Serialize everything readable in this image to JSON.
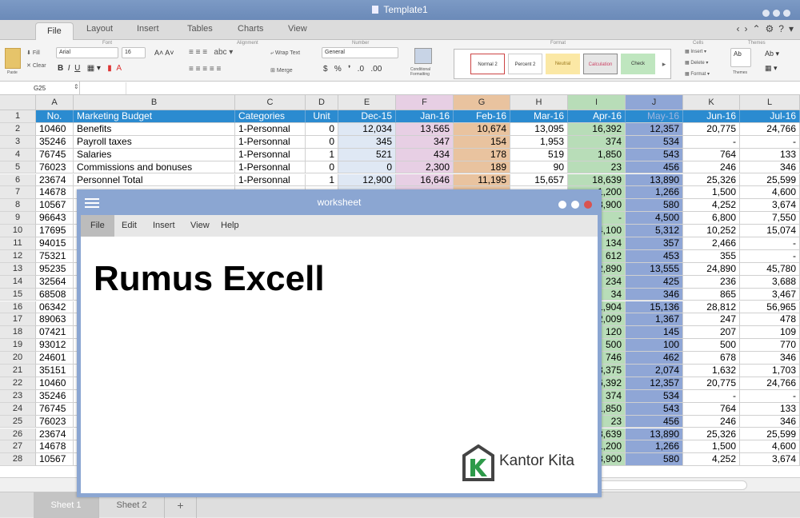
{
  "window": {
    "title": "Template1"
  },
  "tabs": [
    "File",
    "Layout",
    "Insert",
    "Tables",
    "Charts",
    "View"
  ],
  "ribbon": {
    "font_group": "Font",
    "font_name": "Arial",
    "font_size": "16",
    "alignment_group": "Alignment",
    "wrap_text": "Wrap Text",
    "merge": "Merge",
    "number_group": "Number",
    "number_format": "General",
    "format_group": "Format",
    "conditional_formatting": "Conditional Formatting",
    "styles": [
      "Normal 2",
      "Percent 2",
      "Neutral",
      "Calculation",
      "Check"
    ],
    "cells_group": "Cells",
    "cells_items": [
      "Insert",
      "Delete",
      "Format"
    ],
    "themes_group": "Themes",
    "themes_label": "Themes",
    "paste": "Paste",
    "fill": "Fill",
    "clear": "Clear"
  },
  "formula_bar": {
    "name_box": "G25"
  },
  "grid": {
    "col_letters": [
      "A",
      "B",
      "C",
      "D",
      "E",
      "F",
      "G",
      "H",
      "I",
      "J",
      "K",
      "L"
    ],
    "header": [
      "No.",
      "Marketing Budget",
      "Categories",
      "Unit",
      "Dec-15",
      "Jan-16",
      "Feb-16",
      "Mar-16",
      "Apr-16",
      "May-16",
      "Jun-16",
      "Jul-16"
    ],
    "row_numbers": [
      "1",
      "2",
      "3",
      "4",
      "5",
      "6",
      "7",
      "8",
      "9",
      "10",
      "11",
      "12",
      "13",
      "14",
      "15",
      "16",
      "17",
      "18",
      "19",
      "20",
      "21",
      "22",
      "23",
      "24",
      "25",
      "26",
      "27",
      "28"
    ],
    "rows": [
      [
        "10460",
        "Benefits",
        "1-Personnal",
        "0",
        "12,034",
        "13,565",
        "10,674",
        "13,095",
        "16,392",
        "12,357",
        "20,775",
        "24,766"
      ],
      [
        "35246",
        "Payroll taxes",
        "1-Personnal",
        "0",
        "345",
        "347",
        "154",
        "1,953",
        "374",
        "534",
        "-",
        "-"
      ],
      [
        "76745",
        "Salaries",
        "1-Personnal",
        "1",
        "521",
        "434",
        "178",
        "519",
        "1,850",
        "543",
        "764",
        "133"
      ],
      [
        "76023",
        "Commissions and bonuses",
        "1-Personnal",
        "0",
        "0",
        "2,300",
        "189",
        "90",
        "23",
        "456",
        "246",
        "346"
      ],
      [
        "23674",
        "Personnel Total",
        "1-Personnal",
        "1",
        "12,900",
        "16,646",
        "11,195",
        "15,657",
        "18,639",
        "13,890",
        "25,326",
        "25,599"
      ],
      [
        "14678",
        "",
        "",
        "",
        "",
        "",
        "",
        "",
        "1,200",
        "1,266",
        "1,500",
        "4,600"
      ],
      [
        "10567",
        "",
        "",
        "",
        "",
        "",
        "",
        "",
        "3,900",
        "580",
        "4,252",
        "3,674"
      ],
      [
        "96643",
        "",
        "",
        "",
        "",
        "",
        "",
        "",
        "-",
        "4,500",
        "6,800",
        "7,550"
      ],
      [
        "17695",
        "",
        "",
        "",
        "",
        "",
        "",
        "",
        "4,100",
        "5,312",
        "10,252",
        "15,074"
      ],
      [
        "94015",
        "",
        "",
        "",
        "",
        "",
        "",
        "",
        "134",
        "357",
        "2,466",
        "-"
      ],
      [
        "75321",
        "",
        "",
        "",
        "",
        "",
        "",
        "",
        "612",
        "453",
        "355",
        "-"
      ],
      [
        "95235",
        "",
        "",
        "",
        "",
        "",
        "",
        "",
        "12,890",
        "13,555",
        "24,890",
        "45,780"
      ],
      [
        "32564",
        "",
        "",
        "",
        "",
        "",
        "",
        "",
        "234",
        "425",
        "236",
        "3,688"
      ],
      [
        "68508",
        "",
        "",
        "",
        "",
        "",
        "",
        "",
        "34",
        "346",
        "865",
        "3,467"
      ],
      [
        "06342",
        "",
        "",
        "",
        "",
        "",
        "",
        "",
        "21,904",
        "15,136",
        "28,812",
        "56,965"
      ],
      [
        "89063",
        "",
        "",
        "",
        "",
        "",
        "",
        "",
        "2,009",
        "1,367",
        "247",
        "478"
      ],
      [
        "07421",
        "",
        "",
        "",
        "",
        "",
        "",
        "",
        "120",
        "145",
        "207",
        "109"
      ],
      [
        "93012",
        "",
        "",
        "",
        "",
        "",
        "",
        "",
        "500",
        "100",
        "500",
        "770"
      ],
      [
        "24601",
        "",
        "",
        "",
        "",
        "",
        "",
        "",
        "746",
        "462",
        "678",
        "346"
      ],
      [
        "35151",
        "",
        "",
        "",
        "",
        "",
        "",
        "",
        "3,375",
        "2,074",
        "1,632",
        "1,703"
      ],
      [
        "10460",
        "",
        "",
        "",
        "",
        "",
        "",
        "",
        "16,392",
        "12,357",
        "20,775",
        "24,766"
      ],
      [
        "35246",
        "",
        "",
        "",
        "",
        "",
        "",
        "",
        "374",
        "534",
        "-",
        "-"
      ],
      [
        "76745",
        "",
        "",
        "",
        "",
        "",
        "",
        "",
        "1,850",
        "543",
        "764",
        "133"
      ],
      [
        "76023",
        "",
        "",
        "",
        "",
        "",
        "",
        "",
        "23",
        "456",
        "246",
        "346"
      ],
      [
        "23674",
        "",
        "",
        "",
        "",
        "",
        "",
        "",
        "18,639",
        "13,890",
        "25,326",
        "25,599"
      ],
      [
        "14678",
        "",
        "",
        "",
        "",
        "",
        "",
        "",
        "1,200",
        "1,266",
        "1,500",
        "4,600"
      ],
      [
        "10567",
        "",
        "",
        "",
        "",
        "",
        "",
        "",
        "3,900",
        "580",
        "4,252",
        "3,674"
      ]
    ]
  },
  "sheets": [
    "Sheet 1",
    "Sheet 2",
    "+"
  ],
  "overlay": {
    "title": "worksheet",
    "menu": [
      "File",
      "Edit",
      "Insert",
      "View",
      "Help"
    ],
    "heading": "Rumus Excell",
    "logo_text": "Kantor Kita"
  },
  "colors": {
    "header_blue": "#2b8bd0",
    "col_pink": "#e7cfe4",
    "col_orange": "#e9c39f",
    "col_green": "#b8ddb8",
    "col_blue": "#8fa6d6",
    "col_lightblue": "#dfe8f4",
    "overlay_frame": "#8ba6d2"
  }
}
